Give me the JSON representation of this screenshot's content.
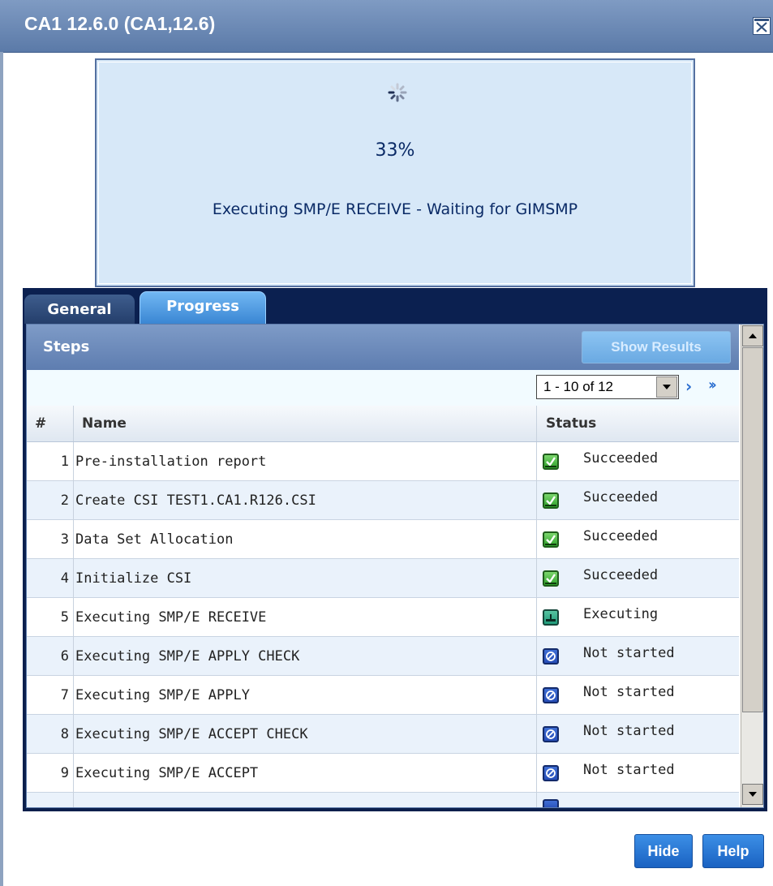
{
  "window": {
    "title": "CA1 12.6.0 (CA1,12.6)",
    "close_icon": "close-icon"
  },
  "progress": {
    "percent_text": "33%",
    "percent_value": 33,
    "message": "Executing SMP/E RECEIVE - Waiting for GIMSMP",
    "spinner_icon": "spinner-icon"
  },
  "tabs": [
    {
      "label": "General",
      "active": false
    },
    {
      "label": "Progress",
      "active": true
    }
  ],
  "steps": {
    "title": "Steps",
    "show_results_label": "Show Results",
    "pager": {
      "selected": "1 - 10 of 12",
      "next_icon": "next-page-icon",
      "last_icon": "last-page-icon"
    },
    "columns": [
      "#",
      "Name",
      "Status"
    ],
    "rows": [
      {
        "num": "1",
        "name": "Pre-installation report",
        "status": "Succeeded",
        "icon": "succeeded-icon"
      },
      {
        "num": "2",
        "name": "Create CSI TEST1.CA1.R126.CSI",
        "status": "Succeeded",
        "icon": "succeeded-icon"
      },
      {
        "num": "3",
        "name": "Data Set Allocation",
        "status": "Succeeded",
        "icon": "succeeded-icon"
      },
      {
        "num": "4",
        "name": "Initialize CSI",
        "status": "Succeeded",
        "icon": "succeeded-icon"
      },
      {
        "num": "5",
        "name": "Executing SMP/E RECEIVE",
        "status": "Executing",
        "icon": "executing-icon"
      },
      {
        "num": "6",
        "name": "Executing SMP/E APPLY CHECK",
        "status": "Not started",
        "icon": "not-started-icon"
      },
      {
        "num": "7",
        "name": "Executing SMP/E APPLY",
        "status": "Not started",
        "icon": "not-started-icon"
      },
      {
        "num": "8",
        "name": "Executing SMP/E ACCEPT CHECK",
        "status": "Not started",
        "icon": "not-started-icon"
      },
      {
        "num": "9",
        "name": "Executing SMP/E ACCEPT",
        "status": "Not started",
        "icon": "not-started-icon"
      }
    ]
  },
  "buttons": {
    "hide": "Hide",
    "help": "Help"
  },
  "colors": {
    "titlebar": "#6a88b5",
    "progress_bg": "#d7e8f8",
    "tab_strip": "#0b2050",
    "accent_button": "#1a62c2"
  }
}
